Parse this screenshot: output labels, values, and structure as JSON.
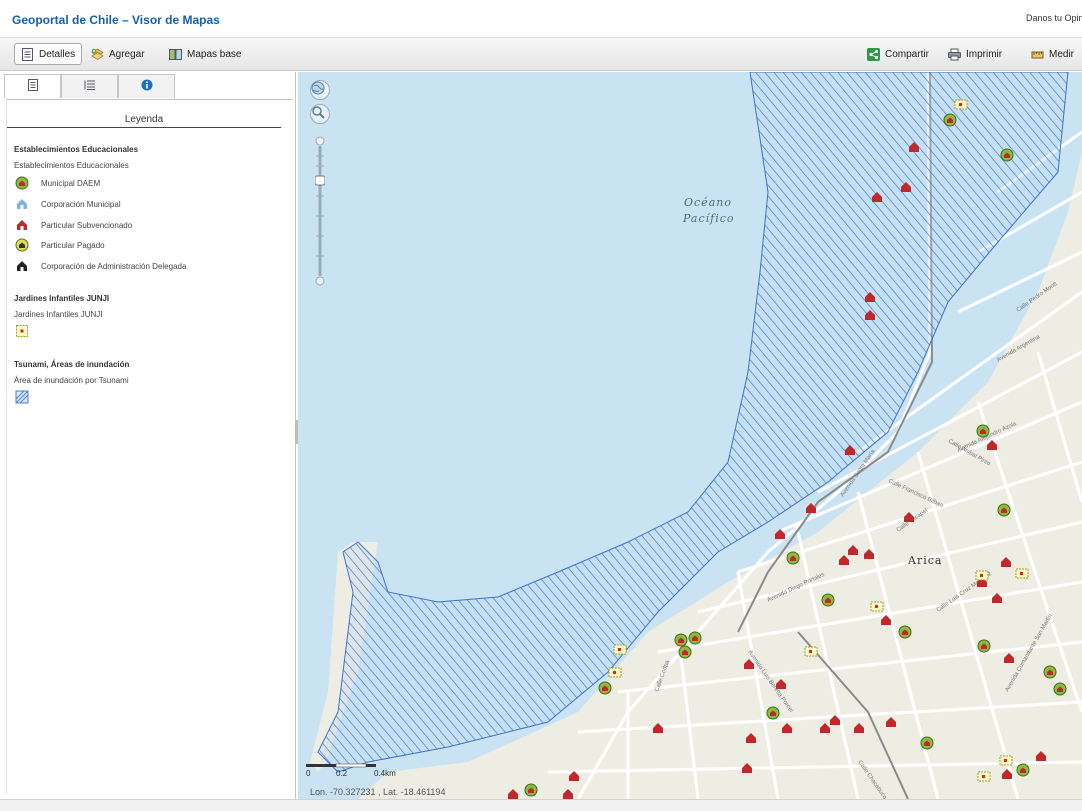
{
  "header": {
    "title": "Geoportal de Chile – Visor de Mapas",
    "feedback": "Danos tu Opinión"
  },
  "toolbar": {
    "left": [
      {
        "label": "Detalles",
        "icon": "details-icon",
        "active": true
      },
      {
        "label": "Agregar",
        "icon": "add-layer-icon",
        "active": false
      },
      {
        "label": "Mapas base",
        "icon": "basemap-icon",
        "active": false
      }
    ],
    "right": [
      {
        "label": "Compartir",
        "icon": "share-icon"
      },
      {
        "label": "Imprimir",
        "icon": "print-icon"
      },
      {
        "label": "Medir",
        "icon": "measure-icon"
      }
    ]
  },
  "panel": {
    "tabs": [
      {
        "icon": "legend-tab-icon",
        "active": true
      },
      {
        "icon": "content-list-tab-icon",
        "active": false
      },
      {
        "icon": "info-tab-icon",
        "active": false
      }
    ],
    "legend_title": "Leyenda",
    "groups": [
      {
        "title": "Establecimientos Educacionales",
        "subtitle": "Establecimientos Educacionales",
        "items": [
          {
            "label": "Municipal DAEM",
            "icon": "municipal-daem-icon",
            "color": "#8dbb3c"
          },
          {
            "label": "Corporación Municipal",
            "icon": "corporacion-municipal-icon",
            "color": "#7fb0e0"
          },
          {
            "label": "Particular Subvencionado",
            "icon": "particular-subvencionado-icon",
            "color": "#c0292b"
          },
          {
            "label": "Particular Pagado",
            "icon": "particular-pagado-icon",
            "color": "#d8e05a"
          },
          {
            "label": "Corporación de Administración Delegada",
            "icon": "corporacion-delegada-icon",
            "color": "#222222"
          }
        ]
      },
      {
        "title": "Jardines Infantiles JUNJI",
        "subtitle": "Jardines Infantiles JUNJI",
        "items": [
          {
            "label": "",
            "icon": "junji-icon",
            "color": "#d22"
          }
        ]
      },
      {
        "title": "Tsunami, Áreas de inundación",
        "subtitle": "Área de inundación por Tsunami",
        "items": [
          {
            "label": "",
            "icon": "tsunami-hatch-icon",
            "color": "#4a7fd0"
          }
        ]
      }
    ]
  },
  "map": {
    "ocean_label_1": "Océano",
    "ocean_label_2": "Pacífico",
    "city_label": "Arica",
    "scale_left": "0",
    "scale_mid": "0.2",
    "scale_right": "0.4km",
    "coordinates": "Lon. -70.327231 , Lat. -18.461194",
    "colors": {
      "water": "#c9e3f3",
      "land": "#eeede4",
      "hatch": "#3f73c8",
      "road": "#ffffff"
    },
    "streets": [
      "Avenida Diego Portales",
      "Avenida Argentina",
      "Avenida Santa María",
      "Calle Pedro Montt",
      "Avenida Alejandro Azola",
      "Calle Francisco Bilbao",
      "Calle Aníbal Pinto",
      "Avenida Luis Beretta Porcel",
      "Calle Luis Cruz Martínez",
      "Calle Codpa",
      "Calle Chacabuco",
      "Avenida Comandante San Martín",
      "Calle Tucapel"
    ]
  }
}
